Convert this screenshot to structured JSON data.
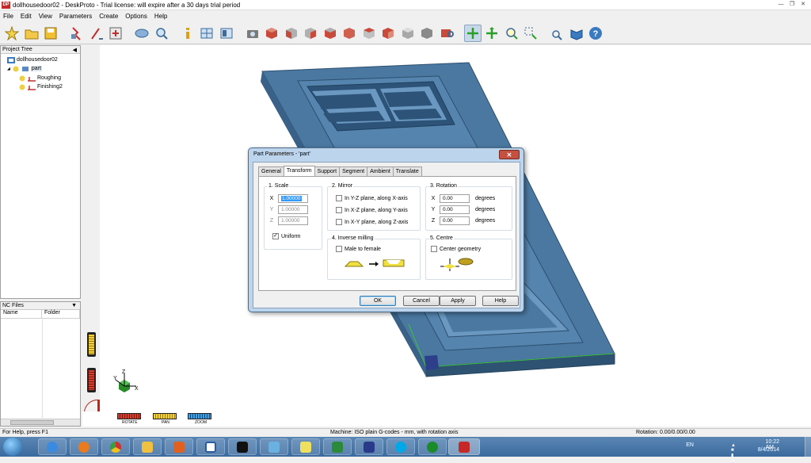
{
  "window": {
    "title": "dollhousedoor02 - DeskProto - Trial license: will expire after a 30 days trial period",
    "app_icon": "DP"
  },
  "menu": [
    "File",
    "Edit",
    "View",
    "Parameters",
    "Create",
    "Options",
    "Help"
  ],
  "project_tree": {
    "header": "Project Tree",
    "items": [
      {
        "label": "dollhousedoor02",
        "icon": "project-icon"
      },
      {
        "label": "part",
        "icon": "part-icon"
      },
      {
        "label": "Roughing",
        "icon": "operation-icon"
      },
      {
        "label": "Finishing2",
        "icon": "operation-icon"
      }
    ]
  },
  "nc_files": {
    "header": "NC Files",
    "columns": [
      "Name",
      "Folder"
    ]
  },
  "view_tools": {
    "rotate": "ROTATE",
    "pan": "PAN",
    "zoom": "ZOOM"
  },
  "axes": {
    "x": "X",
    "y": "Y",
    "z": "Z"
  },
  "dialog": {
    "title": "Part Parameters - 'part'",
    "tabs": [
      "General",
      "Transform",
      "Support",
      "Segment",
      "Ambient",
      "Translate"
    ],
    "active_tab": "Transform",
    "scale": {
      "label": "1. Scale",
      "x_label": "X",
      "y_label": "Y",
      "z_label": "Z",
      "x": "1.00000",
      "y": "1.00000",
      "z": "1.00000",
      "uniform_label": "Uniform",
      "uniform": true
    },
    "mirror": {
      "label": "2. Mirror",
      "opt1": "In Y-Z plane, along X-axis",
      "opt2": "In X-Z plane, along Y-axis",
      "opt3": "In X-Y plane, along Z-axis"
    },
    "rotation": {
      "label": "3. Rotation",
      "x_label": "X",
      "y_label": "Y",
      "z_label": "Z",
      "x": "0.00",
      "y": "0.00",
      "z": "0.00",
      "unit": "degrees"
    },
    "inverse": {
      "label": "4. Inverse milling",
      "option": "Male to female"
    },
    "centre": {
      "label": "5. Centre",
      "option": "Center geometry"
    },
    "buttons": {
      "ok": "OK",
      "cancel": "Cancel",
      "apply": "Apply",
      "help": "Help"
    }
  },
  "status": {
    "left": "For Help, press F1",
    "machine": "Machine: ISO plain G-codes - mm, with rotation axis",
    "rotation": "Rotation: 0.00/0.00/0.00"
  },
  "tray": {
    "lang": "EN",
    "time": "10:22 AM",
    "date": "8/4/2014"
  },
  "colors": {
    "model": "#4a78a0",
    "model_dark": "#34597a",
    "model_light": "#6a98c0",
    "dialog_frame": "#bcd4ec",
    "accent": "#3399ff"
  }
}
